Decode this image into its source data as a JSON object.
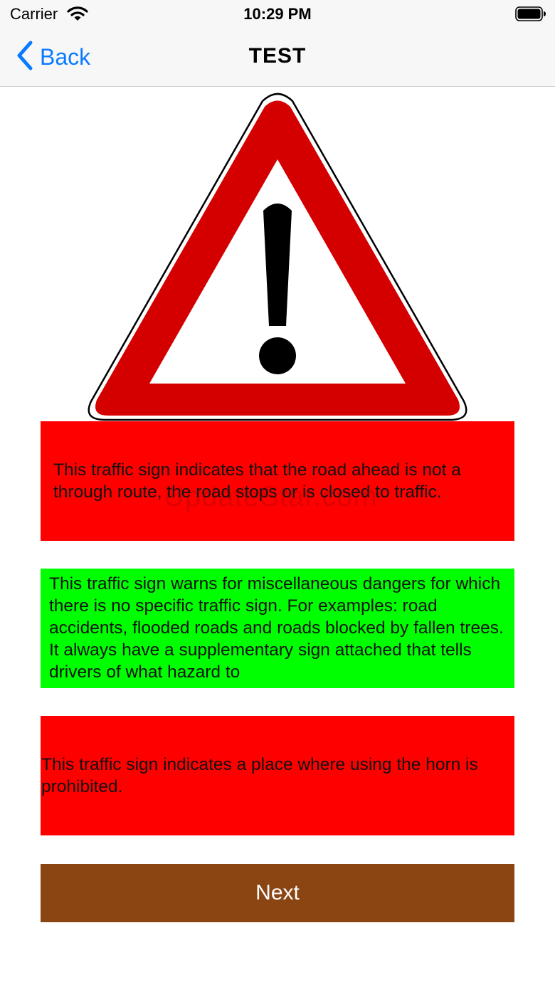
{
  "status_bar": {
    "carrier": "Carrier",
    "time": "10:29 PM"
  },
  "nav": {
    "back_label": "Back",
    "title": "TEST"
  },
  "sign_icon": "danger-warning-triangle",
  "watermark": "UpdateStar.com",
  "answers": [
    {
      "text": "This traffic sign indicates that the road ahead is not a through route, the road stops or is closed to traffic.",
      "color": "#ff0000"
    },
    {
      "text": "This traffic sign warns for miscellaneous dangers for which there is no specific traffic sign. For examples: road accidents, flooded roads and roads blocked by fallen trees. It always have a supplementary sign attached that tells drivers of what hazard to",
      "color": "#00ff00"
    },
    {
      "text": "This traffic sign indicates a place where using the horn is prohibited.",
      "color": "#ff0000"
    }
  ],
  "next_button": {
    "label": "Next",
    "color": "#8b4513"
  },
  "colors": {
    "accent": "#0a7aff",
    "sign_red": "#d40000"
  }
}
